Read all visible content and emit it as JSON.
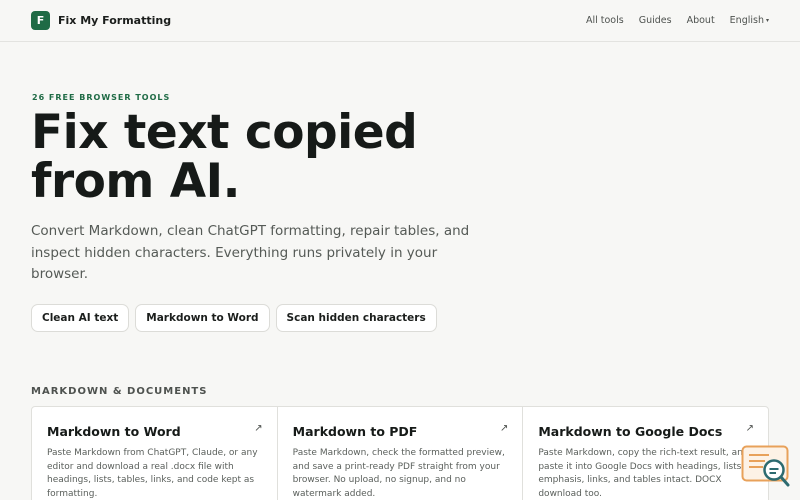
{
  "header": {
    "logo_letter": "F",
    "brand": "Fix My Formatting",
    "nav": [
      "All tools",
      "Guides",
      "About"
    ],
    "language": "English",
    "language_caret": "▾"
  },
  "hero": {
    "eyebrow": "26 FREE BROWSER TOOLS",
    "title": "Fix text copied from AI.",
    "subtitle": "Convert Markdown, clean ChatGPT formatting, repair tables, and inspect hidden characters. Everything runs privately in your browser.",
    "actions": [
      "Clean AI text",
      "Markdown to Word",
      "Scan hidden characters"
    ]
  },
  "section": {
    "label": "MARKDOWN & DOCUMENTS",
    "cards": [
      {
        "title": "Markdown to Word",
        "description": "Paste Markdown from ChatGPT, Claude, or any editor and download a real .docx file with headings, lists, tables, links, and code kept as formatting."
      },
      {
        "title": "Markdown to PDF",
        "description": "Paste Markdown, check the formatted preview, and save a print-ready PDF straight from your browser. No upload, no signup, and no watermark added."
      },
      {
        "title": "Markdown to Google Docs",
        "description": "Paste Markdown, copy the rich-text result, and paste it into Google Docs with headings, lists, emphasis, links, and tables intact. DOCX download too."
      }
    ],
    "card_arrow": "↗"
  },
  "colors": {
    "brand_green": "#1f6b45",
    "widget_orange": "#e8a15a",
    "widget_teal": "#2d6b70"
  },
  "icons": {
    "logo": "letter-f-logo",
    "card_link": "external-arrow-icon",
    "widget": "document-search-icon"
  }
}
